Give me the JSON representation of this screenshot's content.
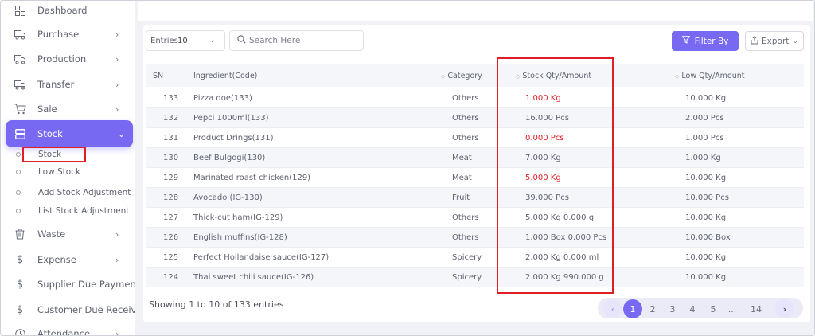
{
  "sidebar": {
    "items": [
      {
        "label": "Dashboard",
        "icon": "dashboard-icon",
        "chevron": ""
      },
      {
        "label": "Purchase",
        "icon": "truck-icon",
        "chevron": "›"
      },
      {
        "label": "Production",
        "icon": "truck-icon",
        "chevron": "›"
      },
      {
        "label": "Transfer",
        "icon": "truck-icon",
        "chevron": "›"
      },
      {
        "label": "Sale",
        "icon": "cart-icon",
        "chevron": "›"
      },
      {
        "label": "Stock",
        "icon": "stack-icon",
        "chevron": "⌄",
        "active": true
      },
      {
        "label": "Waste",
        "icon": "trash-icon",
        "chevron": "›"
      },
      {
        "label": "Expense",
        "icon": "dollar-icon",
        "chevron": "›"
      },
      {
        "label": "Supplier Due Payment",
        "icon": "dollar-icon",
        "chevron": ""
      },
      {
        "label": "Customer Due Receive",
        "icon": "dollar-icon",
        "chevron": ""
      },
      {
        "label": "Attendance",
        "icon": "clock-icon",
        "chevron": "›"
      }
    ],
    "stock_submenu": [
      "Stock",
      "Low Stock",
      "Add Stock Adjustment",
      "List Stock Adjustment"
    ]
  },
  "toolbar": {
    "entries_label": "Entries",
    "entries_value": "10",
    "search_placeholder": "Search Here",
    "filter_label": "Filter By",
    "export_label": "Export"
  },
  "table": {
    "headers": [
      "SN",
      "Ingredient(Code)",
      "Category",
      "Stock Qty/Amount",
      "Low Qty/Amount"
    ],
    "rows": [
      {
        "sn": "133",
        "ingredient": "Pizza doe(133)",
        "category": "Others",
        "stock": "1.000 Kg",
        "low": "10.000 Kg",
        "stock_alert": true
      },
      {
        "sn": "132",
        "ingredient": "Pepci 1000ml(133)",
        "category": "Others",
        "stock": "16.000 Pcs",
        "low": "2.000 Pcs",
        "stock_alert": false
      },
      {
        "sn": "131",
        "ingredient": "Product Drings(131)",
        "category": "Others",
        "stock": "0.000 Pcs",
        "low": "1.000 Pcs",
        "stock_alert": true
      },
      {
        "sn": "130",
        "ingredient": "Beef Bulgogi(130)",
        "category": "Meat",
        "stock": "7.000 Kg",
        "low": "1.000 Kg",
        "stock_alert": false
      },
      {
        "sn": "129",
        "ingredient": "Marinated roast chicken(129)",
        "category": "Meat",
        "stock": "5.000 Kg",
        "low": "10.000 Kg",
        "stock_alert": true
      },
      {
        "sn": "128",
        "ingredient": "Avocado (IG-130)",
        "category": "Fruit",
        "stock": "39.000 Pcs",
        "low": "10.000 Pcs",
        "stock_alert": false
      },
      {
        "sn": "127",
        "ingredient": "Thick-cut ham(IG-129)",
        "category": "Others",
        "stock": "5.000 Kg 0.000 g",
        "low": "10.000 Kg",
        "stock_alert": false
      },
      {
        "sn": "126",
        "ingredient": "English muffins(IG-128)",
        "category": "Others",
        "stock": "1.000 Box 0.000 Pcs",
        "low": "10.000 Box",
        "stock_alert": false
      },
      {
        "sn": "125",
        "ingredient": "Perfect Hollandaise sauce(IG-127)",
        "category": "Spicery",
        "stock": "2.000 Kg 0.000 ml",
        "low": "10.000 Kg",
        "stock_alert": false
      },
      {
        "sn": "124",
        "ingredient": "Thai sweet chili sauce(IG-126)",
        "category": "Spicery",
        "stock": "2.000 Kg 990.000 g",
        "low": "10.000 Kg",
        "stock_alert": false
      }
    ]
  },
  "footer": {
    "showing": "Showing 1 to 10 of 133 entries",
    "pages": [
      "1",
      "2",
      "3",
      "4",
      "5",
      "...",
      "14"
    ],
    "current_page": "1",
    "prev": "‹",
    "next": "›"
  },
  "colors": {
    "accent": "#7769f2",
    "alert": "#e01e25"
  }
}
